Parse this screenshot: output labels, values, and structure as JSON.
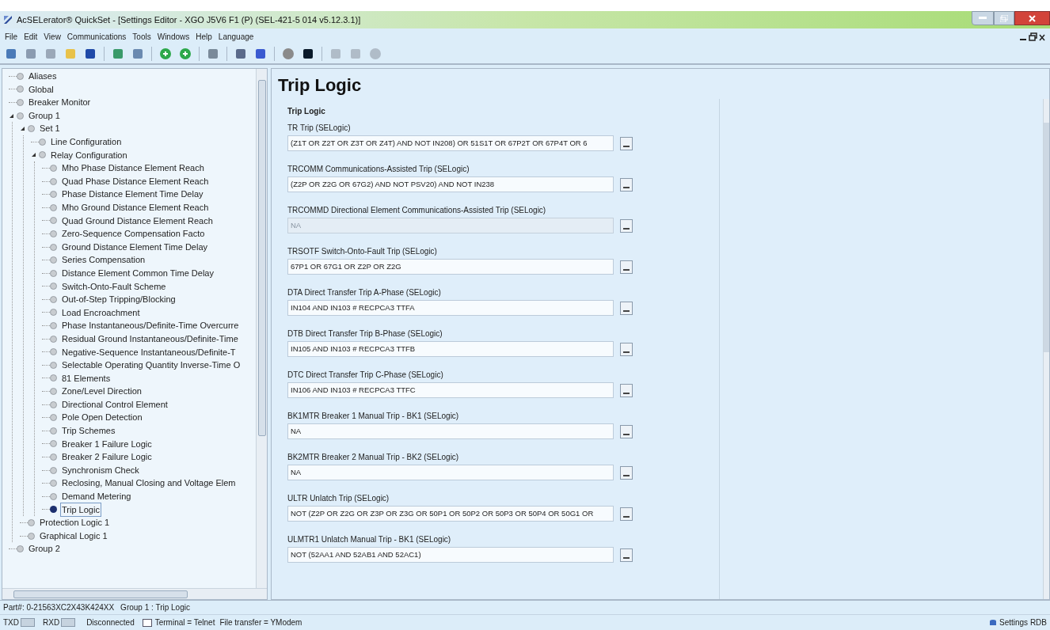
{
  "window": {
    "title": "AcSELerator® QuickSet - [Settings Editor - XGO J5V6 F1 (P) (SEL-421-5 014 v5.12.3.1)]"
  },
  "menu": [
    "File",
    "Edit",
    "View",
    "Communications",
    "Tools",
    "Windows",
    "Help",
    "Language"
  ],
  "tree": [
    {
      "label": "Aliases",
      "selected": false
    },
    {
      "label": "Global",
      "selected": false
    },
    {
      "label": "Breaker Monitor",
      "selected": false
    },
    {
      "label": "Group 1",
      "selected": false,
      "expanded": true,
      "children": [
        {
          "label": "Set 1",
          "selected": false,
          "expanded": true,
          "children": [
            {
              "label": "Line Configuration",
              "selected": false
            },
            {
              "label": "Relay Configuration",
              "selected": false,
              "expanded": true,
              "children": [
                {
                  "label": "Mho Phase Distance Element Reach",
                  "selected": false
                },
                {
                  "label": "Quad Phase Distance Element Reach",
                  "selected": false
                },
                {
                  "label": "Phase Distance Element Time Delay",
                  "selected": false
                },
                {
                  "label": "Mho Ground Distance Element Reach",
                  "selected": false
                },
                {
                  "label": "Quad Ground Distance Element Reach",
                  "selected": false
                },
                {
                  "label": "Zero-Sequence Compensation Facto",
                  "selected": false
                },
                {
                  "label": "Ground Distance Element Time Delay",
                  "selected": false
                },
                {
                  "label": "Series Compensation",
                  "selected": false
                },
                {
                  "label": "Distance Element Common Time Delay",
                  "selected": false
                },
                {
                  "label": "Switch-Onto-Fault Scheme",
                  "selected": false
                },
                {
                  "label": "Out-of-Step Tripping/Blocking",
                  "selected": false
                },
                {
                  "label": "Load Encroachment",
                  "selected": false
                },
                {
                  "label": "Phase Instantaneous/Definite-Time Overcurre",
                  "selected": false
                },
                {
                  "label": "Residual Ground Instantaneous/Definite-Time",
                  "selected": false
                },
                {
                  "label": "Negative-Sequence Instantaneous/Definite-T",
                  "selected": false
                },
                {
                  "label": "Selectable Operating Quantity Inverse-Time O",
                  "selected": false
                },
                {
                  "label": "81 Elements",
                  "selected": false
                },
                {
                  "label": "Zone/Level Direction",
                  "selected": false
                },
                {
                  "label": "Directional Control Element",
                  "selected": false
                },
                {
                  "label": "Pole Open Detection",
                  "selected": false
                },
                {
                  "label": "Trip Schemes",
                  "selected": false
                },
                {
                  "label": "Breaker 1 Failure Logic",
                  "selected": false
                },
                {
                  "label": "Breaker 2 Failure Logic",
                  "selected": false
                },
                {
                  "label": "Synchronism Check",
                  "selected": false
                },
                {
                  "label": "Reclosing, Manual Closing and Voltage Elem",
                  "selected": false
                },
                {
                  "label": "Demand Metering",
                  "selected": false
                },
                {
                  "label": "Trip Logic",
                  "selected": true
                }
              ]
            }
          ]
        },
        {
          "label": "Protection Logic 1",
          "selected": false
        },
        {
          "label": "Graphical Logic 1",
          "selected": false
        }
      ]
    },
    {
      "label": "Group 2",
      "selected": false
    }
  ],
  "editor": {
    "title": "Trip Logic",
    "section": "Trip Logic",
    "fields": [
      {
        "label": "TR Trip (SELogic)",
        "value": "(Z1T OR Z2T OR Z3T OR Z4T) AND NOT IN208) OR 51S1T OR 67P2T OR 67P4T OR 6",
        "disabled": false
      },
      {
        "label": "TRCOMM Communications-Assisted Trip (SELogic)",
        "value": "(Z2P OR Z2G OR 67G2) AND NOT PSV20) AND NOT IN238",
        "disabled": false
      },
      {
        "label": "TRCOMMD Directional Element Communications-Assisted Trip (SELogic)",
        "value": "NA",
        "disabled": true
      },
      {
        "label": "TRSOTF Switch-Onto-Fault Trip (SELogic)",
        "value": "67P1 OR 67G1 OR Z2P OR Z2G",
        "disabled": false
      },
      {
        "label": "DTA Direct Transfer Trip A-Phase (SELogic)",
        "value": "IN104 AND IN103 # RECPCA3 TTFA",
        "disabled": false
      },
      {
        "label": "DTB Direct Transfer Trip B-Phase (SELogic)",
        "value": "IN105 AND IN103 # RECPCA3 TTFB",
        "disabled": false
      },
      {
        "label": "DTC Direct Transfer Trip C-Phase (SELogic)",
        "value": "IN106 AND IN103 # RECPCA3 TTFC",
        "disabled": false
      },
      {
        "label": "BK1MTR Breaker 1 Manual Trip - BK1 (SELogic)",
        "value": "NA",
        "disabled": false
      },
      {
        "label": "BK2MTR Breaker 2 Manual Trip - BK2 (SELogic)",
        "value": "NA",
        "disabled": false
      },
      {
        "label": "ULTR Unlatch Trip (SELogic)",
        "value": "NOT (Z2P OR Z2G OR Z3P OR Z3G OR 50P1 OR 50P2 OR 50P3 OR 50P4 OR 50G1 OR",
        "disabled": false
      },
      {
        "label": "ULMTR1 Unlatch Manual Trip - BK1 (SELogic)",
        "value": "NOT (52AA1 AND 52AB1 AND 52AC1)",
        "disabled": false
      }
    ]
  },
  "status_bar": {
    "part": "Part#: 0-21563XC2X43K424XX",
    "location": "Group 1 : Trip Logic",
    "txd": "TXD",
    "rxd": "RXD",
    "connection": "Disconnected",
    "terminal": "Terminal = Telnet",
    "file_transfer": "File transfer = YModem",
    "settings": "Settings RDB"
  }
}
